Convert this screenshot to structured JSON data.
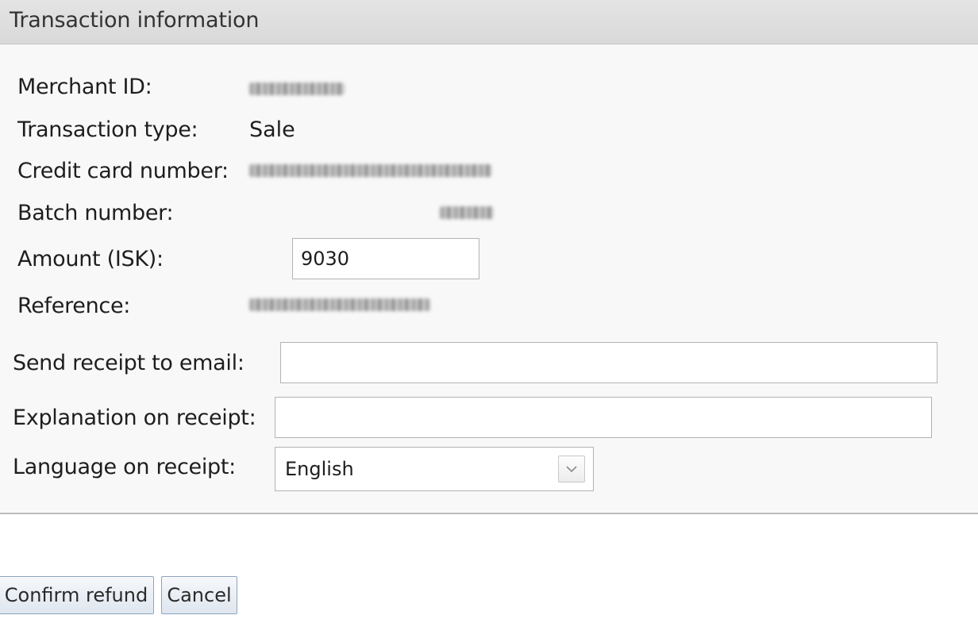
{
  "panel": {
    "title": "Transaction information"
  },
  "fields": {
    "merchant_id_label": "Merchant ID:",
    "transaction_type_label": "Transaction type:",
    "transaction_type_value": "Sale",
    "credit_card_label": "Credit card number:",
    "batch_number_label": "Batch number:",
    "amount_label": "Amount (ISK):",
    "amount_value": "9030",
    "reference_label": "Reference:",
    "email_label": "Send receipt to email:",
    "email_value": "",
    "explanation_label": "Explanation on receipt:",
    "explanation_value": "",
    "language_label": "Language on receipt:",
    "language_selected": "English"
  },
  "actions": {
    "confirm_label": "Confirm refund",
    "cancel_label": "Cancel"
  },
  "icons": {
    "select_arrow": "chevron-down-icon"
  }
}
